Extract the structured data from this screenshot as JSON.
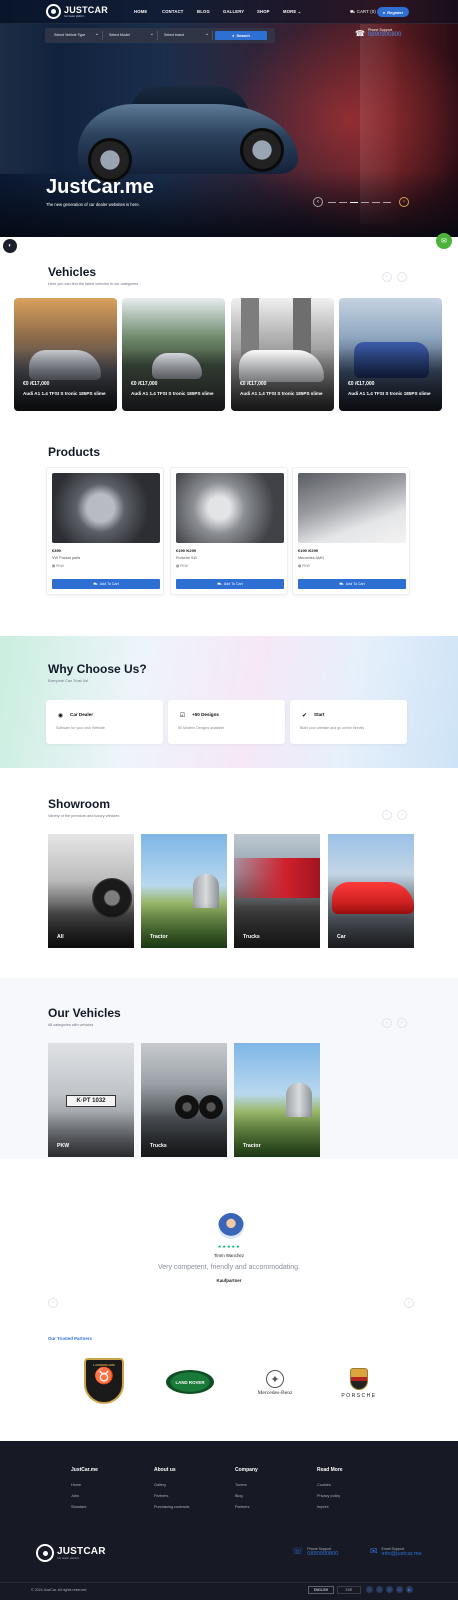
{
  "brand": {
    "name": "JUSTCAR",
    "tagline": "Car dealer platform"
  },
  "nav": {
    "links": [
      "HOME",
      "CONTACT",
      "BLOG",
      "GALLERY",
      "SHOP",
      "MORE"
    ],
    "cart": "CART (0)",
    "register": "Register"
  },
  "search": {
    "vehicle_type": "Select Vehicle Type",
    "model": "Select Model",
    "brand": "Select brand",
    "button": "Search"
  },
  "support": {
    "label": "Phone Support",
    "phone": "0890900800"
  },
  "hero": {
    "title": "JustCar.me",
    "subtitle": "The new generation of car dealer websites is here."
  },
  "vehicles": {
    "title": "Vehicles",
    "subtitle": "Here you can find the latest vehicles in our categories",
    "items": [
      {
        "price": "€0 /€17,000",
        "name": "Audi A1 1.4 TFSI S tronic 185PS slime"
      },
      {
        "price": "€0 /€17,000",
        "name": "Audi A1 1.4 TFSI S tronic 185PS slime"
      },
      {
        "price": "€0 /€17,000",
        "name": "Audi A1 1.4 TFSI S tronic 185PS slime"
      },
      {
        "price": "€0 /€17,000",
        "name": "Audi A1 1.4 TFSI S tronic 185PS slime"
      }
    ]
  },
  "products": {
    "title": "Products",
    "add_to_cart": "Add To Cart",
    "items": [
      {
        "price": "€399",
        "name": "VW Passat parts",
        "category": "PKW"
      },
      {
        "price": "€199 /€299",
        "name": "Porsche 911",
        "category": "PKW"
      },
      {
        "price": "€199 /€299",
        "name": "Mercedes AMG",
        "category": "PKW"
      }
    ]
  },
  "why": {
    "title": "Why Choose Us?",
    "subtitle": "Everyone Can Trust Us!",
    "items": [
      {
        "title": "Car Dealer",
        "text": "Software for your own Website"
      },
      {
        "title": "+50 Designs",
        "text": "50 Modern Designs available"
      },
      {
        "title": "Start",
        "text": "Build your website and go online directly"
      }
    ]
  },
  "showroom": {
    "title": "Showroom",
    "subtitle": "Variety of the premium and luxury vehicles",
    "items": [
      "All",
      "Tractor",
      "Trucks",
      "Car"
    ]
  },
  "our_vehicles": {
    "title": "Our Vehicles",
    "subtitle": "All categories with vehicles",
    "items": [
      "PKW",
      "Trucks",
      "Tractor"
    ]
  },
  "testimonial": {
    "stars": "★★★★★",
    "name": "Timm Wanchez",
    "quote": "Very competent, friendly and accommodating.",
    "role": "Kaufpartner"
  },
  "partners": {
    "title": "Our Trusted Partners",
    "items": [
      "LAMBORGHINI",
      "LAND ROVER",
      "Mercedes-Benz",
      "PORSCHE"
    ]
  },
  "footer": {
    "columns": [
      {
        "title": "JustCar.me",
        "links": [
          "Home",
          "Jobs",
          "Standard"
        ]
      },
      {
        "title": "About us",
        "links": [
          "Gallery",
          "Partners",
          "Purchasing contracts"
        ]
      },
      {
        "title": "Company",
        "links": [
          "Tuners",
          "Blog",
          "Partners"
        ]
      },
      {
        "title": "Read More",
        "links": [
          "Cookies",
          "Privacy policy",
          "Imprint"
        ]
      }
    ],
    "phone_label": "Phone Support",
    "phone": "0890900800",
    "mail_label": "Email Support",
    "mail": "info@justcar.me",
    "copyright": "© 2024 JustCar. All rights reserved",
    "lang_label": "ENGLISH",
    "currency_label": "EUR"
  },
  "colors": {
    "accent": "#2e6fd3",
    "footer": "#171a24",
    "chat": "#4bb33a"
  }
}
